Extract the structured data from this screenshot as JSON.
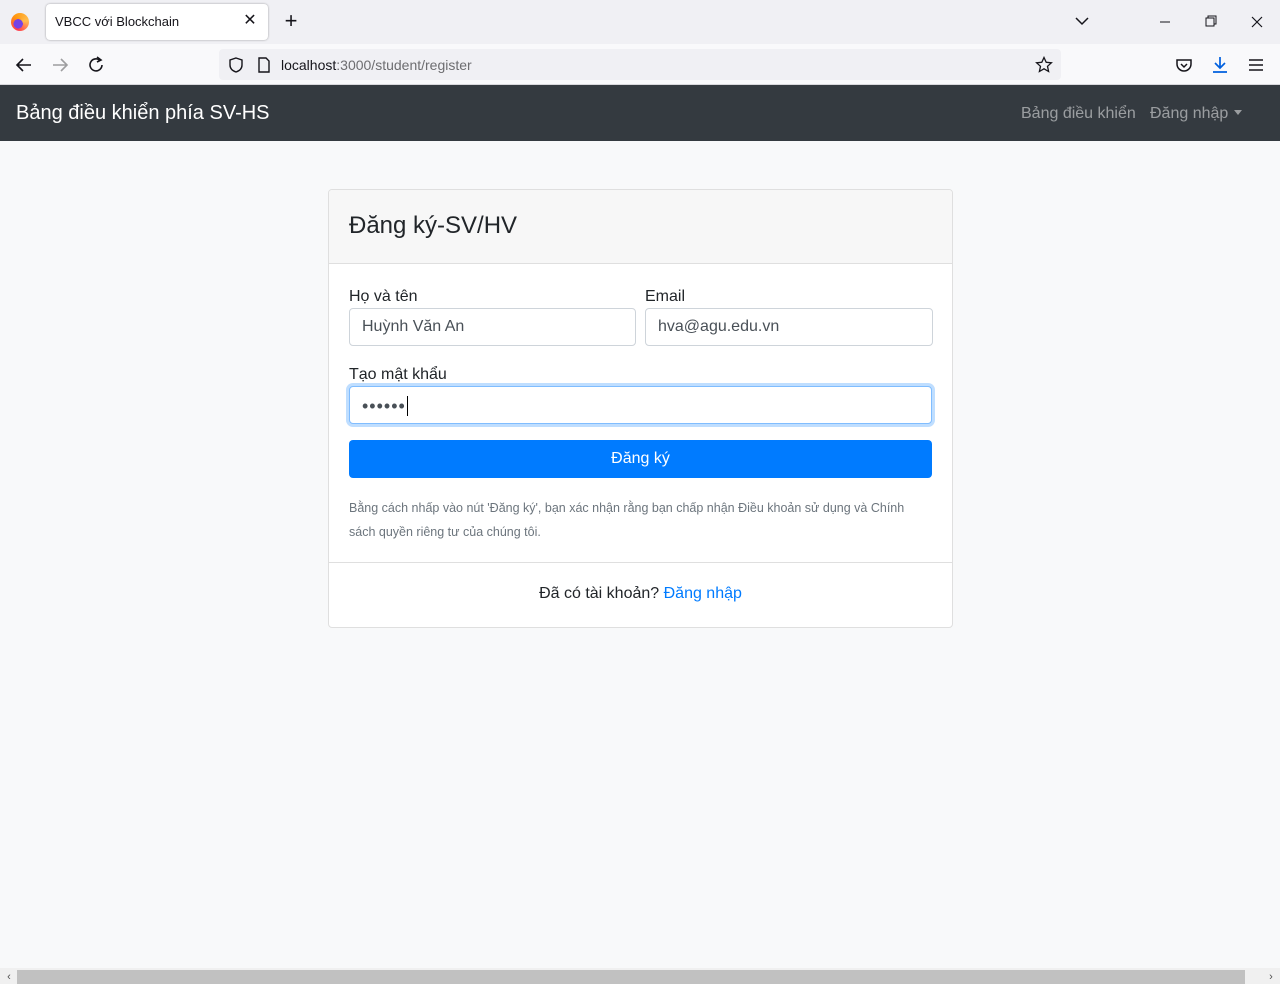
{
  "browser": {
    "tab_title": "VBCC với Blockchain",
    "url_host": "localhost",
    "url_rest": ":3000/student/register"
  },
  "app": {
    "brand": "Bảng điều khiển phía SV-HS",
    "nav_dashboard": "Bảng điều khiển",
    "nav_login": "Đăng nhập"
  },
  "form": {
    "title": "Đăng ký-SV/HV",
    "name_label": "Họ và tên",
    "name_value": "Huỳnh Văn An",
    "email_label": "Email",
    "email_value": "hva@agu.edu.vn",
    "password_label": "Tạo mật khẩu",
    "password_value": "••••••",
    "submit_label": "Đăng ký",
    "terms_text": "Bằng cách nhấp vào nút 'Đăng ký', bạn xác nhận rằng bạn chấp nhận Điều khoản sử dụng và Chính sách quyền riêng tư của chúng tôi.",
    "footer_prompt": "Đã có tài khoản?",
    "footer_link": "Đăng nhập"
  },
  "colors": {
    "navbar_bg": "#343a40",
    "primary": "#007bff"
  }
}
